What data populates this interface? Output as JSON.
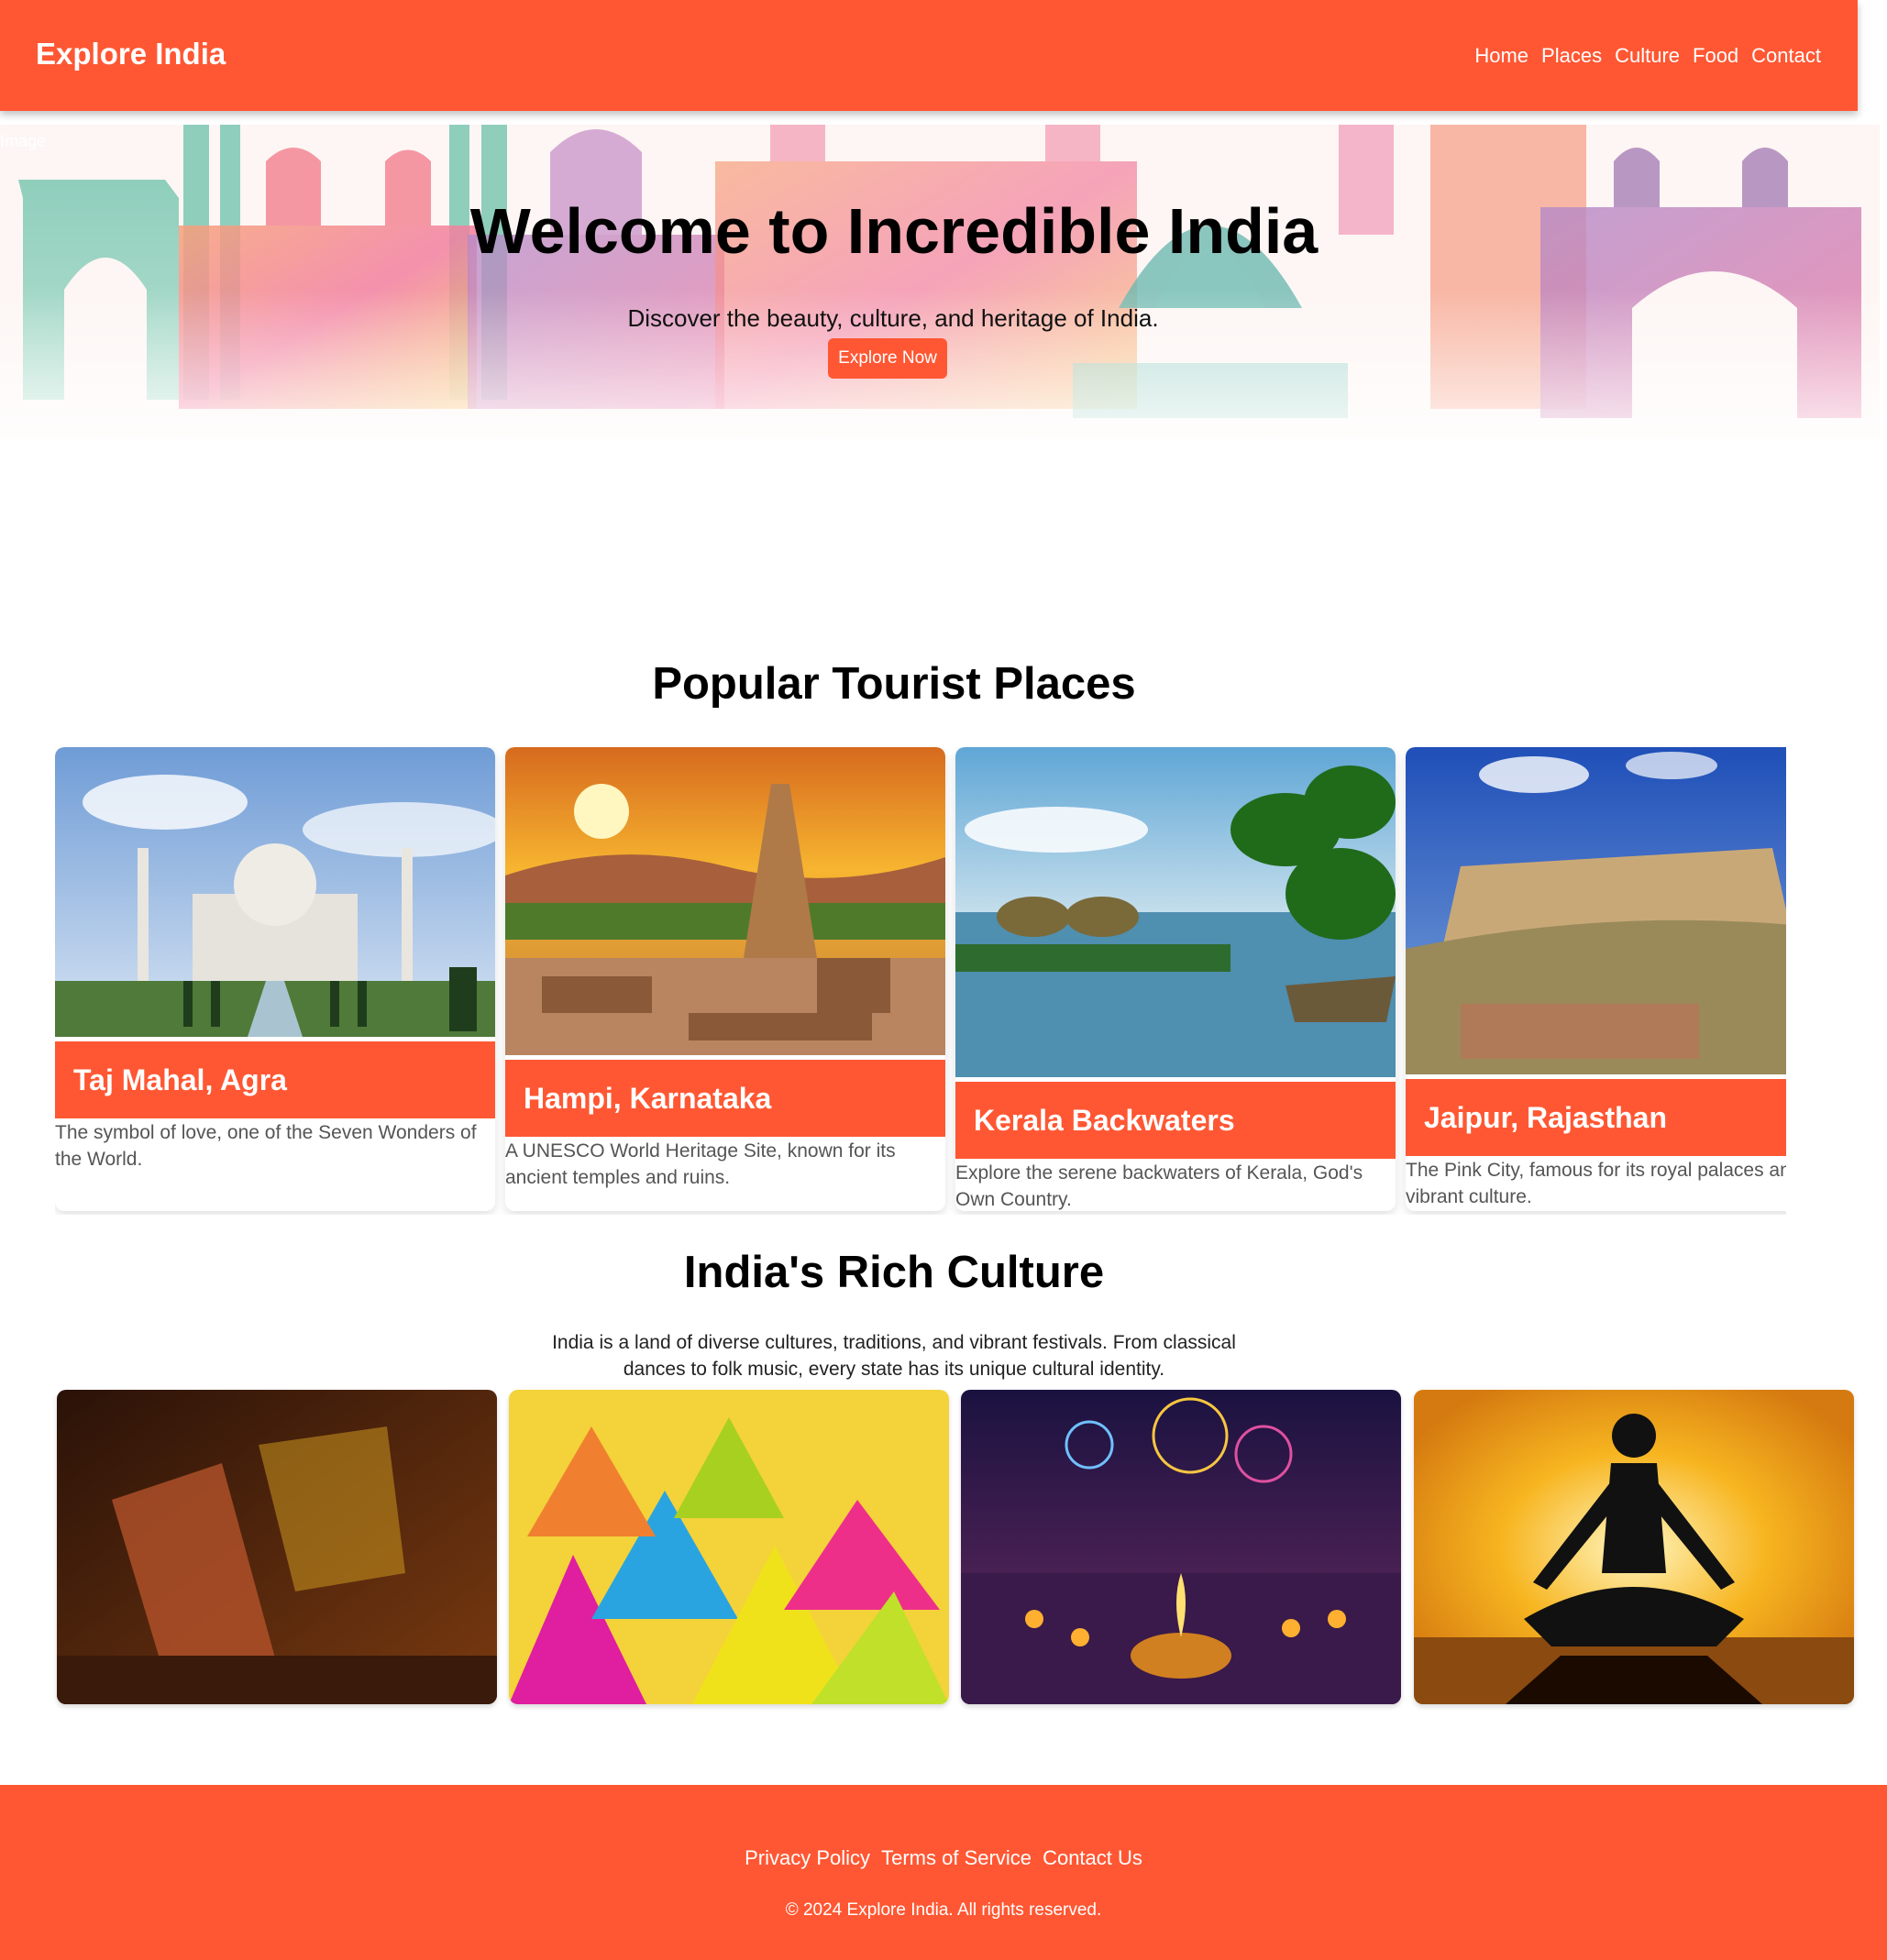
{
  "header": {
    "brand": "Explore India",
    "nav": [
      "Home",
      "Places",
      "Culture",
      "Food",
      "Contact"
    ]
  },
  "hero": {
    "image_alt": "Image",
    "title": "Welcome to Incredible India",
    "subtitle": "Discover the beauty, culture, and heritage of India.",
    "button": "Explore Now"
  },
  "places": {
    "title": "Popular Tourist Places",
    "items": [
      {
        "name": "Taj Mahal, Agra",
        "desc": "The symbol of love, one of the Seven Wonders of the World."
      },
      {
        "name": "Hampi, Karnataka",
        "desc": "A UNESCO World Heritage Site, known for its ancient temples and ruins."
      },
      {
        "name": "Kerala Backwaters",
        "desc": "Explore the serene backwaters of Kerala, God's Own Country."
      },
      {
        "name": "Jaipur, Rajasthan",
        "desc": "The Pink City, famous for its royal palaces and vibrant culture."
      }
    ]
  },
  "culture": {
    "title": "India's Rich Culture",
    "text": "India is a land of diverse cultures, traditions, and vibrant festivals. From classical dances to folk music, every state has its unique cultural identity."
  },
  "footer": {
    "links": [
      "Privacy Policy",
      "Terms of Service",
      "Contact Us"
    ],
    "copyright": "© 2024 Explore India. All rights reserved."
  },
  "colors": {
    "accent": "#ff5733"
  }
}
